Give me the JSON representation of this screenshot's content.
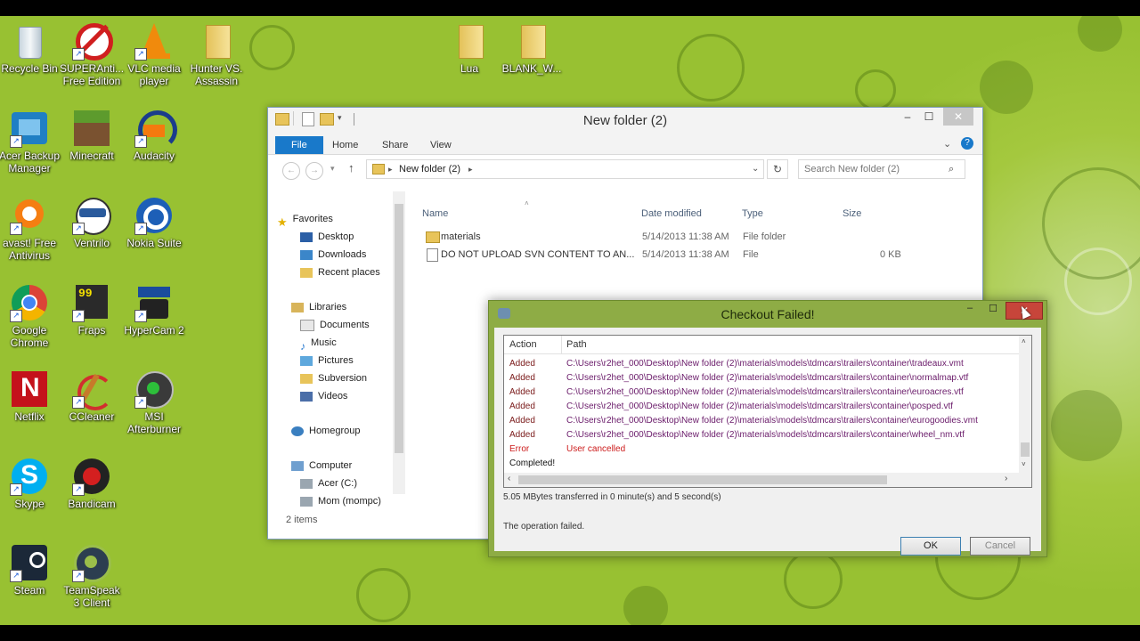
{
  "desktop": {
    "icons": [
      {
        "label": "Recycle Bin",
        "icon": "recycle-bin-icon"
      },
      {
        "label": "SUPERAnti... Free Edition",
        "icon": "superantispyware-icon"
      },
      {
        "label": "VLC media player",
        "icon": "vlc-icon"
      },
      {
        "label": "Hunter VS. Assassin",
        "icon": "folder-icon"
      },
      {
        "label": "Lua",
        "icon": "folder-icon"
      },
      {
        "label": "BLANK_W...",
        "icon": "folder-icon"
      },
      {
        "label": "Acer Backup Manager",
        "icon": "acer-backup-icon"
      },
      {
        "label": "Minecraft",
        "icon": "minecraft-icon"
      },
      {
        "label": "Audacity",
        "icon": "audacity-icon"
      },
      {
        "label": "avast! Free Antivirus",
        "icon": "avast-icon"
      },
      {
        "label": "Ventrilo",
        "icon": "ventrilo-icon"
      },
      {
        "label": "Nokia Suite",
        "icon": "nokia-suite-icon"
      },
      {
        "label": "Google Chrome",
        "icon": "chrome-icon"
      },
      {
        "label": "Fraps",
        "icon": "fraps-icon"
      },
      {
        "label": "HyperCam 2",
        "icon": "hypercam-icon"
      },
      {
        "label": "Netflix",
        "icon": "netflix-icon"
      },
      {
        "label": "CCleaner",
        "icon": "ccleaner-icon"
      },
      {
        "label": "MSI Afterburner",
        "icon": "msi-afterburner-icon"
      },
      {
        "label": "Skype",
        "icon": "skype-icon"
      },
      {
        "label": "Bandicam",
        "icon": "bandicam-icon"
      },
      {
        "label": "Steam",
        "icon": "steam-icon"
      },
      {
        "label": "TeamSpeak 3 Client",
        "icon": "teamspeak-icon"
      }
    ]
  },
  "explorer": {
    "title": "New folder (2)",
    "ribbon_tabs": [
      "File",
      "Home",
      "Share",
      "View"
    ],
    "address": "New folder (2)",
    "search_placeholder": "Search New folder (2)",
    "nav": {
      "favorites": "Favorites",
      "favorites_items": [
        "Desktop",
        "Downloads",
        "Recent places"
      ],
      "libraries": "Libraries",
      "libraries_items": [
        "Documents",
        "Music",
        "Pictures",
        "Subversion",
        "Videos"
      ],
      "homegroup": "Homegroup",
      "computer": "Computer",
      "computer_items": [
        "Acer (C:)",
        "Mom (mompc)"
      ]
    },
    "columns": [
      "Name",
      "Date modified",
      "Type",
      "Size"
    ],
    "files": [
      {
        "name": "materials",
        "date": "5/14/2013 11:38 AM",
        "type": "File folder",
        "size": ""
      },
      {
        "name": "DO NOT UPLOAD SVN CONTENT TO AN...",
        "date": "5/14/2013 11:38 AM",
        "type": "File",
        "size": "0 KB"
      }
    ],
    "status": "2 items"
  },
  "dialog": {
    "title": "Checkout Failed!",
    "columns": [
      "Action",
      "Path"
    ],
    "rows": [
      {
        "action": "Added",
        "path": "C:\\Users\\r2het_000\\Desktop\\New folder (2)\\materials\\models\\tdmcars\\trailers\\container\\tradeaux.vmt",
        "status": "added"
      },
      {
        "action": "Added",
        "path": "C:\\Users\\r2het_000\\Desktop\\New folder (2)\\materials\\models\\tdmcars\\trailers\\container\\normalmap.vtf",
        "status": "added"
      },
      {
        "action": "Added",
        "path": "C:\\Users\\r2het_000\\Desktop\\New folder (2)\\materials\\models\\tdmcars\\trailers\\container\\euroacres.vtf",
        "status": "added"
      },
      {
        "action": "Added",
        "path": "C:\\Users\\r2het_000\\Desktop\\New folder (2)\\materials\\models\\tdmcars\\trailers\\container\\posped.vtf",
        "status": "added"
      },
      {
        "action": "Added",
        "path": "C:\\Users\\r2het_000\\Desktop\\New folder (2)\\materials\\models\\tdmcars\\trailers\\container\\eurogoodies.vmt",
        "status": "added"
      },
      {
        "action": "Added",
        "path": "C:\\Users\\r2het_000\\Desktop\\New folder (2)\\materials\\models\\tdmcars\\trailers\\container\\wheel_nm.vtf",
        "status": "added"
      },
      {
        "action": "Error",
        "path": "User cancelled",
        "status": "error"
      },
      {
        "action": "Completed!",
        "path": "",
        "status": "completed"
      }
    ],
    "transfer_text": "5.05 MBytes transferred in 0 minute(s) and 5 second(s)",
    "message": "The operation failed.",
    "ok_label": "OK",
    "cancel_label": "Cancel"
  },
  "colors": {
    "desktop_bg": "#98c132",
    "dialog_frame": "#8eac45",
    "added_text": "#7a1a1a",
    "path_text": "#6a1b6a",
    "error_text": "#cc1b1b",
    "file_tab": "#1979ca",
    "close_red": "#c7453a"
  }
}
